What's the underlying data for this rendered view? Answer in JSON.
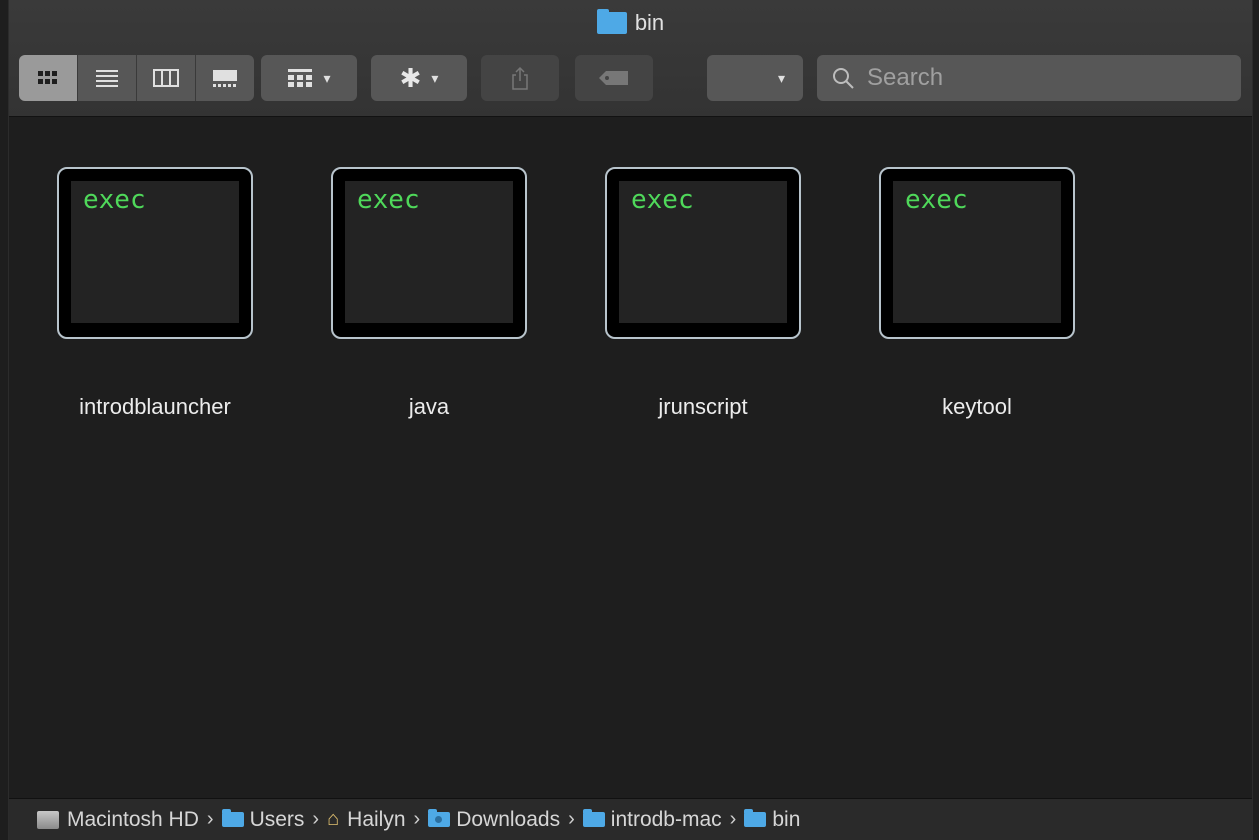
{
  "window": {
    "title": "bin"
  },
  "toolbar": {
    "view_modes": [
      "icon-view",
      "list-view",
      "column-view",
      "gallery-view"
    ],
    "active_view": "icon-view",
    "group_button": "group-by-icon",
    "action_button": "gear-icon",
    "share_button": "share-icon",
    "tag_button": "tag-icon",
    "path_dropdown_value": "",
    "search_placeholder": "Search"
  },
  "files": [
    {
      "name": "introdblauncher",
      "icon_text": "exec"
    },
    {
      "name": "java",
      "icon_text": "exec"
    },
    {
      "name": "jrunscript",
      "icon_text": "exec"
    },
    {
      "name": "keytool",
      "icon_text": "exec"
    }
  ],
  "pathbar": {
    "items": [
      {
        "label": "Macintosh HD",
        "icon": "hard-drive-icon"
      },
      {
        "label": "Users",
        "icon": "users-folder-icon"
      },
      {
        "label": "Hailyn",
        "icon": "home-icon"
      },
      {
        "label": "Downloads",
        "icon": "downloads-folder-icon"
      },
      {
        "label": "introdb-mac",
        "icon": "folder-icon"
      },
      {
        "label": "bin",
        "icon": "folder-icon"
      }
    ],
    "separator": "›"
  },
  "colors": {
    "accent_folder": "#4ea9e6",
    "exec_text": "#4fd85a",
    "background": "#1e1e1e"
  }
}
